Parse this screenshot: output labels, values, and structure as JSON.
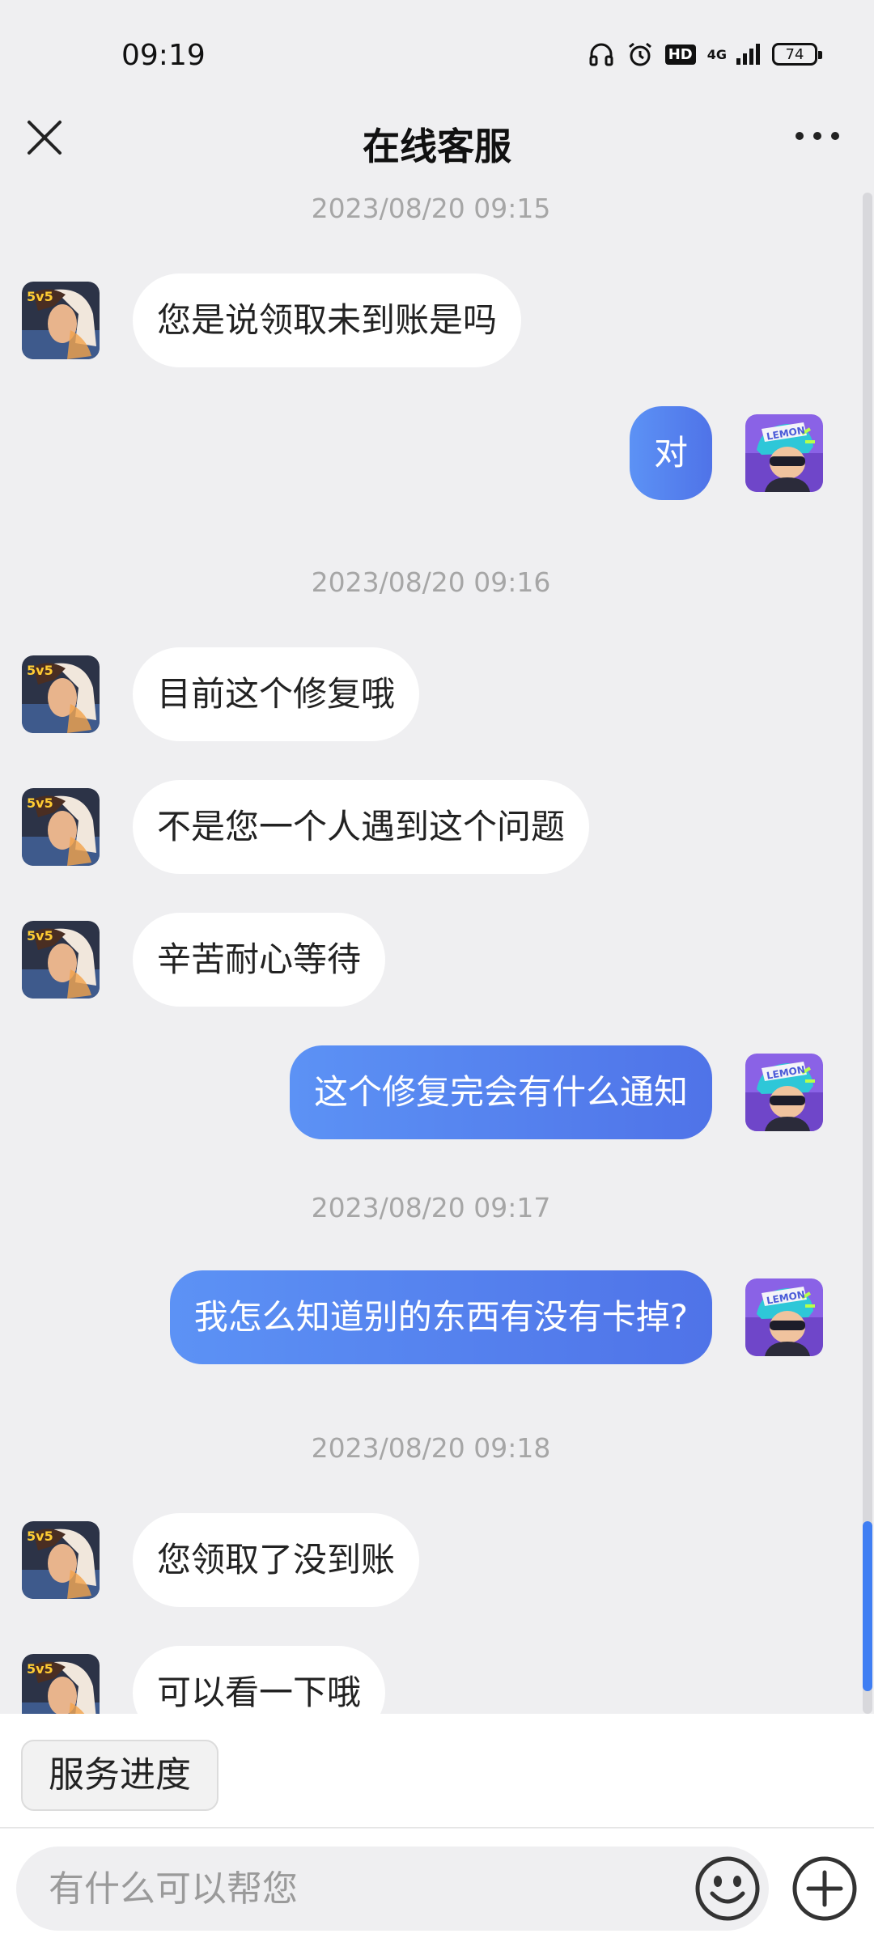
{
  "status": {
    "time": "09:19",
    "network": "4G",
    "hd": "HD",
    "battery": "74"
  },
  "header": {
    "title": "在线客服"
  },
  "messages": [
    {
      "type": "timestamp",
      "text": "2023/08/20 09:15"
    },
    {
      "side": "left",
      "text": "您是说领取未到账是吗"
    },
    {
      "side": "right",
      "text": "对"
    },
    {
      "type": "timestamp",
      "text": "2023/08/20 09:16"
    },
    {
      "side": "left",
      "text": "目前这个修复哦"
    },
    {
      "side": "left",
      "text": "不是您一个人遇到这个问题"
    },
    {
      "side": "left",
      "text": "辛苦耐心等待"
    },
    {
      "side": "right",
      "text": "这个修复完会有什么通知"
    },
    {
      "type": "timestamp",
      "text": "2023/08/20 09:17"
    },
    {
      "side": "right",
      "text": "我怎么知道别的东西有没有卡掉?"
    },
    {
      "type": "timestamp",
      "text": "2023/08/20 09:18"
    },
    {
      "side": "left",
      "text": "您领取了没到账"
    },
    {
      "side": "left",
      "text": "可以看一下哦"
    }
  ],
  "avatars": {
    "agent_badge": "5v5",
    "user_badge": "LEMON"
  },
  "quick_actions": {
    "service_progress": "服务进度"
  },
  "input": {
    "placeholder": "有什么可以帮您"
  }
}
